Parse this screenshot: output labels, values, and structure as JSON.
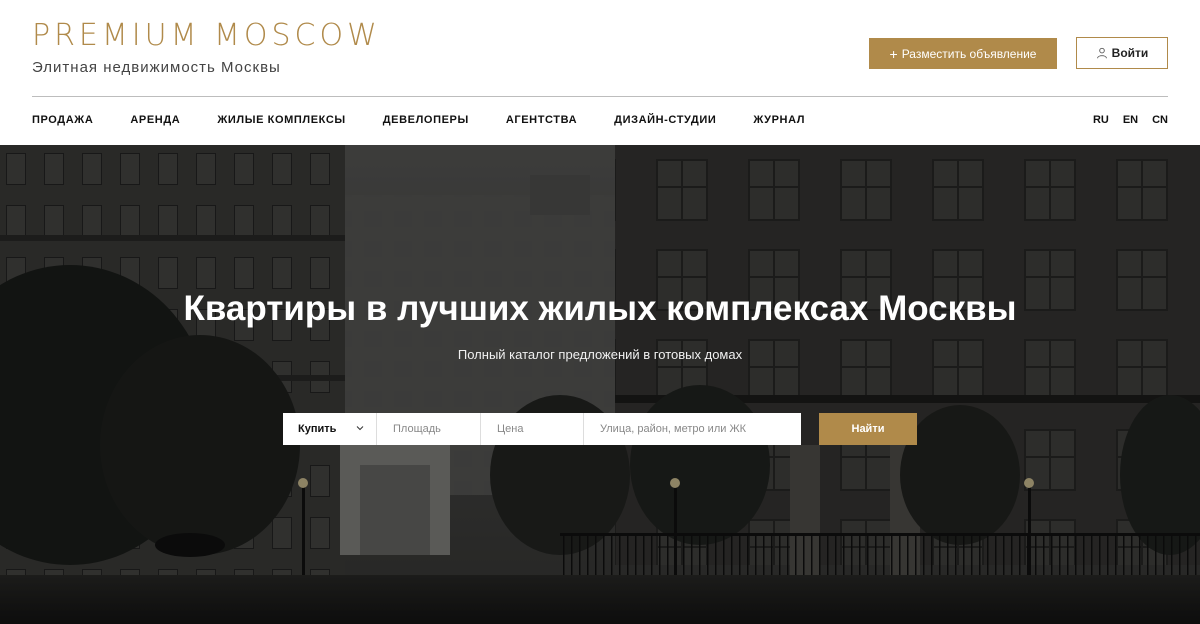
{
  "header": {
    "logo_title": "PREMIUM MOSCOW",
    "logo_subtitle": "Элитная недвижимость Москвы",
    "post_ad_label": "Разместить объявление",
    "login_label": "Войти"
  },
  "nav": {
    "items": [
      {
        "label": "ПРОДАЖА"
      },
      {
        "label": "АРЕНДА"
      },
      {
        "label": "ЖИЛЫЕ КОМПЛЕКСЫ"
      },
      {
        "label": "ДЕВЕЛОПЕРЫ"
      },
      {
        "label": "АГЕНТСТВА"
      },
      {
        "label": "ДИЗАЙН-СТУДИИ"
      },
      {
        "label": "ЖУРНАЛ"
      }
    ],
    "languages": [
      "RU",
      "EN",
      "CN"
    ]
  },
  "hero": {
    "title": "Квартиры в лучших жилых комплексах Москвы",
    "subtitle": "Полный каталог предложений в готовых домах"
  },
  "search": {
    "deal_type": "Купить",
    "area_placeholder": "Площадь",
    "price_placeholder": "Цена",
    "address_placeholder": "Улица, район, метро или ЖК",
    "submit_label": "Найти"
  },
  "colors": {
    "accent": "#b08a4a",
    "hero_dark": "#2e2e2e"
  },
  "icons": {
    "post_ad": "plus-icon",
    "login": "user-icon",
    "deal_select": "chevron-down-icon"
  }
}
